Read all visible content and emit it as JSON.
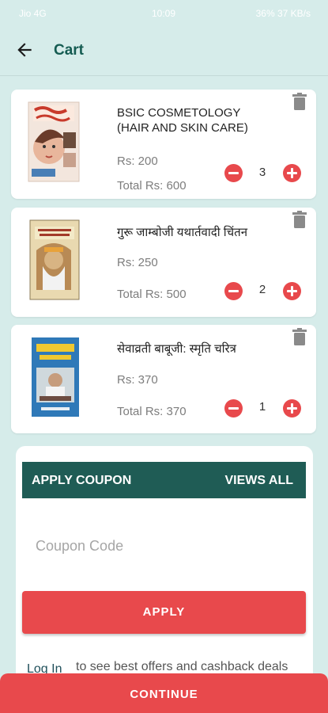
{
  "status_bar": {
    "carrier": "Jio 4G",
    "time": "10:09",
    "right": "36% 37 KB/s"
  },
  "appbar": {
    "title": "Cart",
    "back_icon": "arrow-left-icon"
  },
  "items": [
    {
      "name": "BSIC COSMETOLOGY (HAIR AND SKIN CARE)",
      "price": "Rs: 200",
      "total": "Total Rs: 600",
      "qty": "3"
    },
    {
      "name": "गुरू जाम्बोजी यथार्तवादी चिंतन",
      "price": "Rs: 250",
      "total": "Total Rs: 500",
      "qty": "2"
    },
    {
      "name": "सेवाव्रती बाबूजी: स्मृति चरित्र",
      "price": "Rs: 370",
      "total": "Total Rs: 370",
      "qty": "1"
    }
  ],
  "coupon": {
    "header_left": "APPLY COUPON",
    "header_right": "VIEWS ALL",
    "placeholder": "Coupon Code",
    "apply_label": "APPLY",
    "login_label": "Log In",
    "offers_text": "to see best offers and cashback deals"
  },
  "continue_label": "CONTINUE",
  "colors": {
    "accent_red": "#e8494c",
    "teal_dark": "#1f5c55",
    "background": "#d6ecea"
  }
}
